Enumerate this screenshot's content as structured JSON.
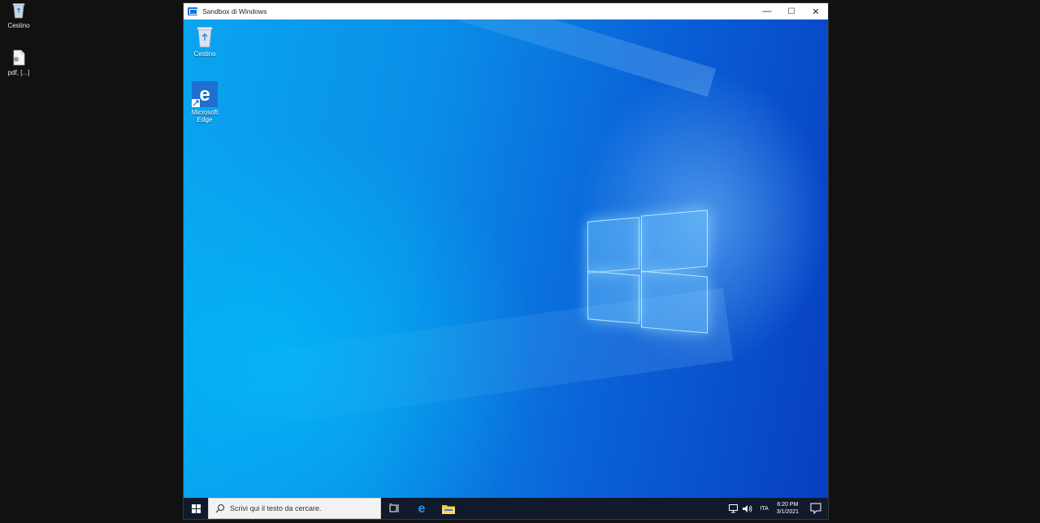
{
  "host_desktop": {
    "icons": [
      {
        "label": "Cestino",
        "icon": "recycle-bin-icon"
      },
      {
        "label": "pdf, [...]",
        "icon": "document-icon"
      }
    ]
  },
  "window": {
    "title": "Sandbox di Windows",
    "controls": {
      "minimize": "—",
      "maximize": "☐",
      "close": "✕"
    }
  },
  "sandbox_desktop": {
    "icons": [
      {
        "label": "Cestino",
        "icon": "recycle-bin-icon"
      },
      {
        "label": "Microsoft Edge",
        "icon": "edge-icon"
      }
    ]
  },
  "taskbar": {
    "search_placeholder": "Scrivi qui il testo da cercare.",
    "language": "ITA",
    "time": "6:20 PM",
    "date": "3/1/2021"
  },
  "colors": {
    "taskbar_bg": "#101a2b",
    "wallpaper_light": "#0aa5f0",
    "wallpaper_dark": "#073fc2",
    "host_bg": "#111111"
  }
}
